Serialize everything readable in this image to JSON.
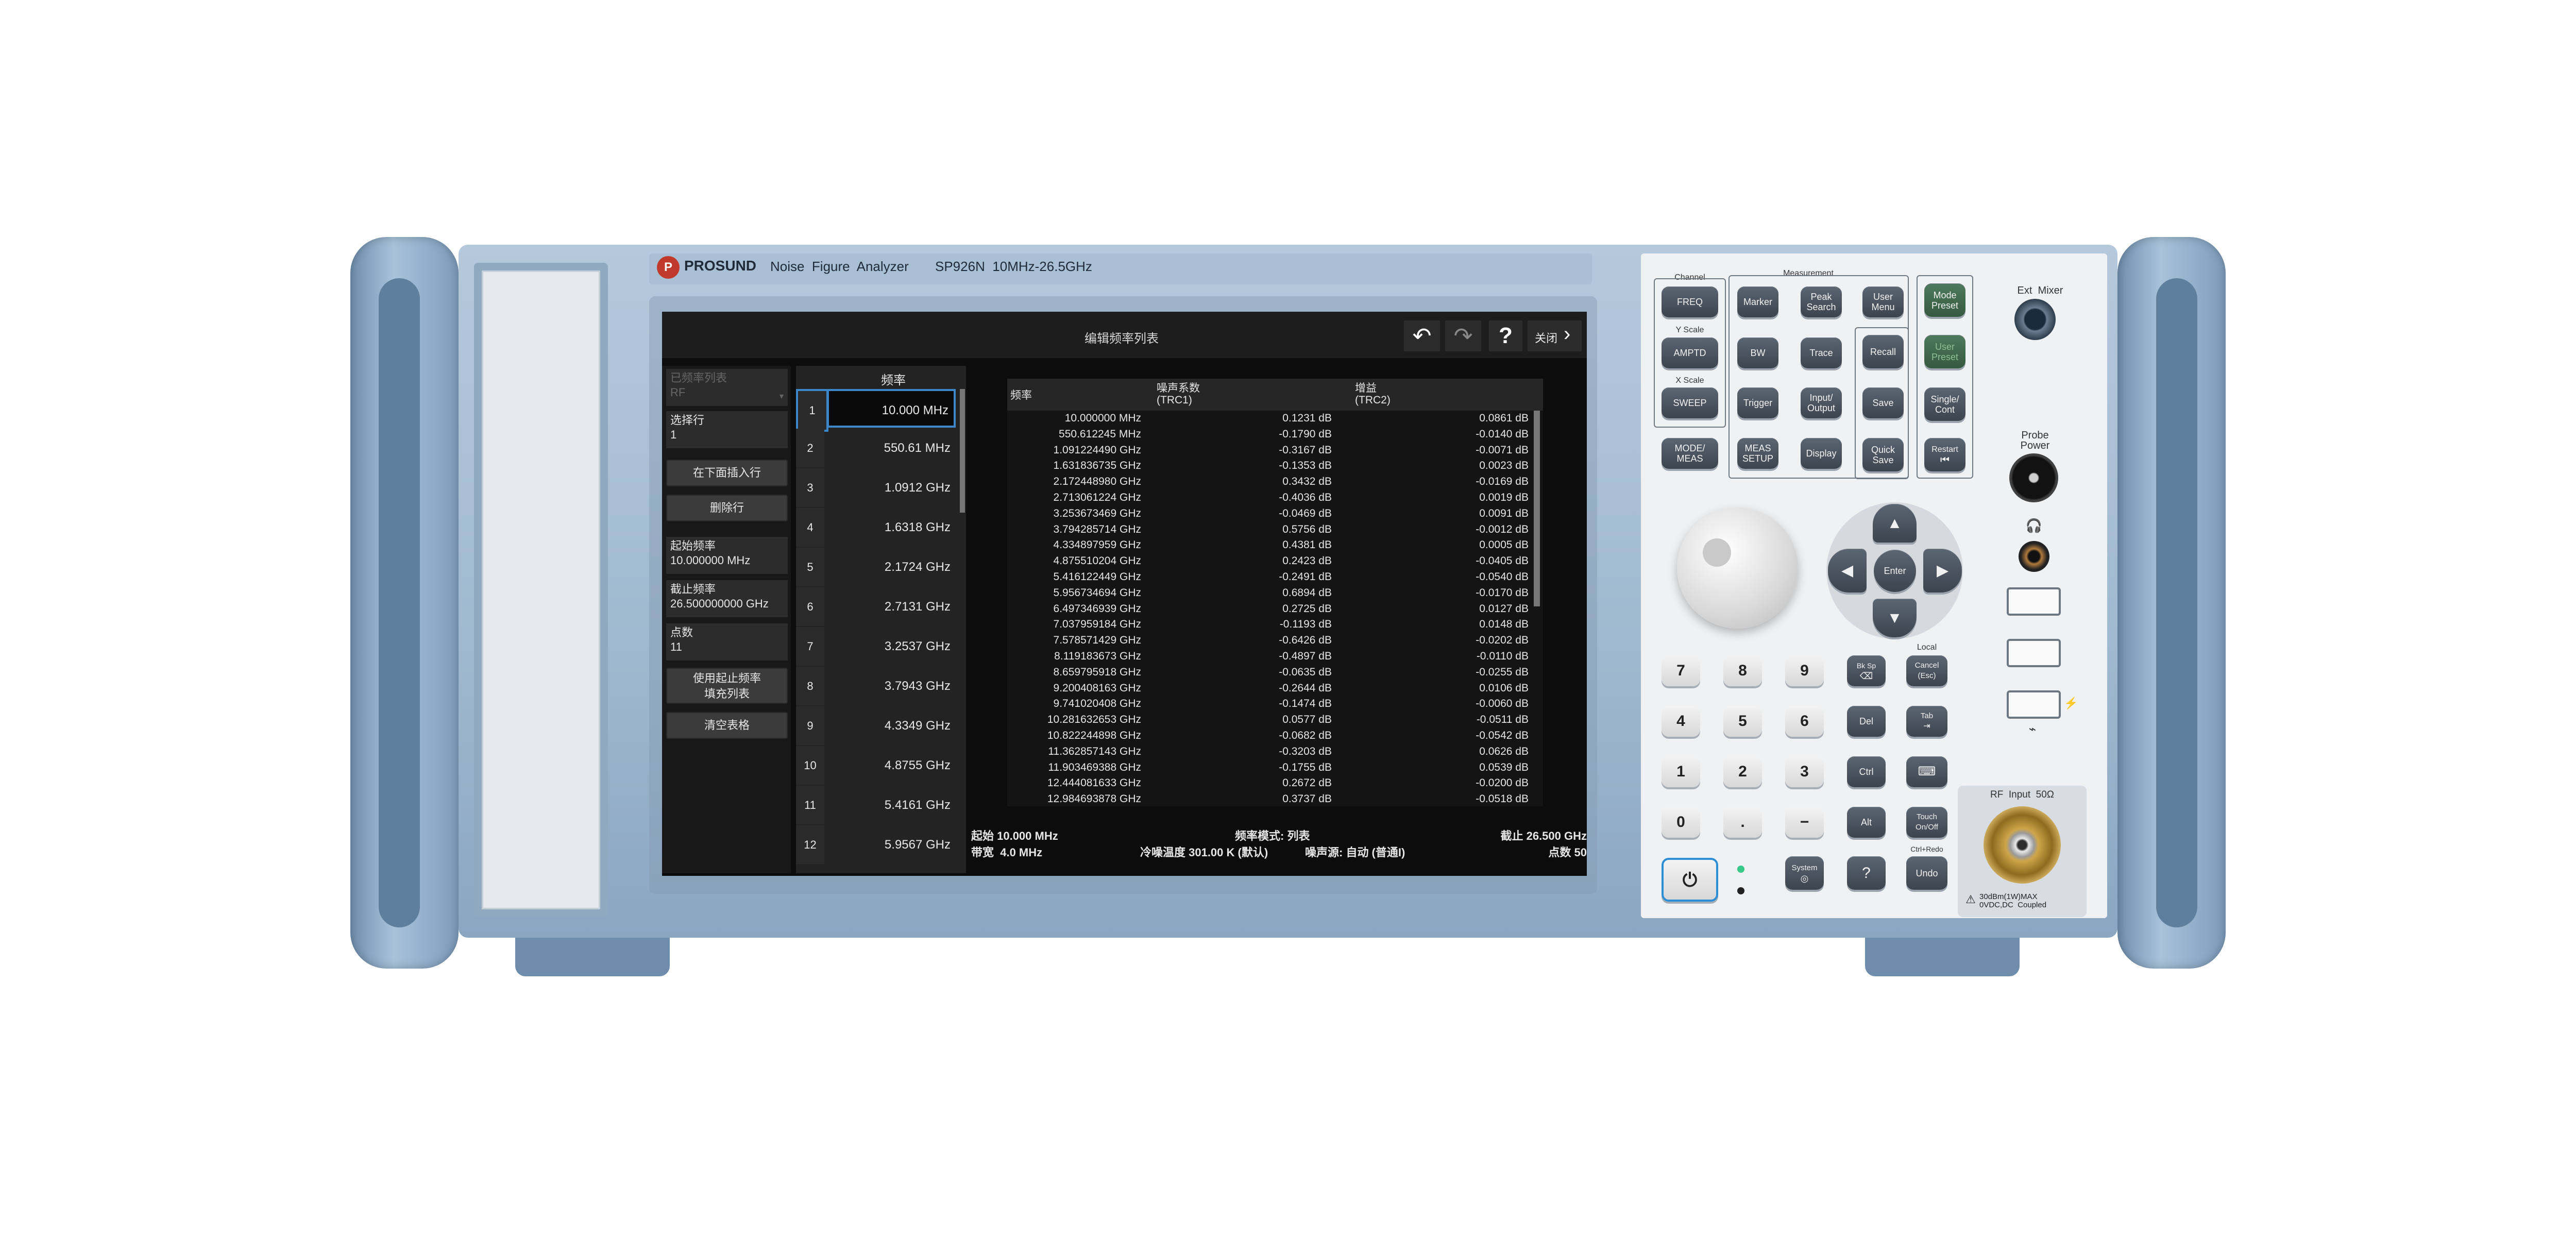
{
  "brand": {
    "logo": "PROSUND",
    "product": "Noise  Figure  Analyzer",
    "model": "SP926N  10MHz-26.5GHz"
  },
  "screen": {
    "dialog_title": "编辑频率列表",
    "close_label": "关闭",
    "left_panel": {
      "list_selector_label": "已频率列表",
      "list_selector_value": "RF",
      "select_row_label": "选择行",
      "select_row_value": "1",
      "insert_below": "在下面插入行",
      "delete_row": "删除行",
      "start_freq_label": "起始频率",
      "start_freq_value": "10.000000 MHz",
      "stop_freq_label": "截止频率",
      "stop_freq_value": "26.500000000 GHz",
      "points_label": "点数",
      "points_value": "11",
      "fill_list": "使用起止频率\n填充列表",
      "clear_table": "清空表格"
    },
    "freq_list": {
      "header": "频率",
      "rows": [
        {
          "n": "1",
          "f": "10.000 MHz"
        },
        {
          "n": "2",
          "f": "550.61 MHz"
        },
        {
          "n": "3",
          "f": "1.0912 GHz"
        },
        {
          "n": "4",
          "f": "1.6318 GHz"
        },
        {
          "n": "5",
          "f": "2.1724 GHz"
        },
        {
          "n": "6",
          "f": "2.7131 GHz"
        },
        {
          "n": "7",
          "f": "3.2537 GHz"
        },
        {
          "n": "8",
          "f": "3.7943 GHz"
        },
        {
          "n": "9",
          "f": "4.3349 GHz"
        },
        {
          "n": "10",
          "f": "4.8755 GHz"
        },
        {
          "n": "11",
          "f": "5.4161 GHz"
        },
        {
          "n": "12",
          "f": "5.9567 GHz"
        }
      ]
    },
    "results_table": {
      "col_freq": "频率",
      "col_nf": "噪声系数",
      "col_nf_sub": "(TRC1)",
      "col_gain": "增益",
      "col_gain_sub": "(TRC2)",
      "rows": [
        [
          "10.000000 MHz",
          "0.1231 dB",
          "0.0861 dB"
        ],
        [
          "550.612245 MHz",
          "-0.1790 dB",
          "-0.0140 dB"
        ],
        [
          "1.091224490 GHz",
          "-0.3167 dB",
          "-0.0071 dB"
        ],
        [
          "1.631836735 GHz",
          "-0.1353 dB",
          "0.0023 dB"
        ],
        [
          "2.172448980 GHz",
          "0.3432 dB",
          "-0.0169 dB"
        ],
        [
          "2.713061224 GHz",
          "-0.4036 dB",
          "0.0019 dB"
        ],
        [
          "3.253673469 GHz",
          "-0.0469 dB",
          "0.0091 dB"
        ],
        [
          "3.794285714 GHz",
          "0.5756 dB",
          "-0.0012 dB"
        ],
        [
          "4.334897959 GHz",
          "0.4381 dB",
          "0.0005 dB"
        ],
        [
          "4.875510204 GHz",
          "0.2423 dB",
          "-0.0405 dB"
        ],
        [
          "5.416122449 GHz",
          "-0.2491 dB",
          "-0.0540 dB"
        ],
        [
          "5.956734694 GHz",
          "0.6894 dB",
          "-0.0170 dB"
        ],
        [
          "6.497346939 GHz",
          "0.2725 dB",
          "0.0127 dB"
        ],
        [
          "7.037959184 GHz",
          "-0.1193 dB",
          "0.0148 dB"
        ],
        [
          "7.578571429 GHz",
          "-0.6426 dB",
          "-0.0202 dB"
        ],
        [
          "8.119183673 GHz",
          "-0.4897 dB",
          "-0.0110 dB"
        ],
        [
          "8.659795918 GHz",
          "-0.0635 dB",
          "-0.0255 dB"
        ],
        [
          "9.200408163 GHz",
          "-0.2644 dB",
          "0.0106 dB"
        ],
        [
          "9.741020408 GHz",
          "-0.1474 dB",
          "-0.0060 dB"
        ],
        [
          "10.281632653 GHz",
          "0.0577 dB",
          "-0.0511 dB"
        ],
        [
          "10.822244898 GHz",
          "-0.0682 dB",
          "-0.0542 dB"
        ],
        [
          "11.362857143 GHz",
          "-0.3203 dB",
          "0.0626 dB"
        ],
        [
          "11.903469388 GHz",
          "-0.1755 dB",
          "0.0539 dB"
        ],
        [
          "12.444081633 GHz",
          "0.2672 dB",
          "-0.0200 dB"
        ],
        [
          "12.984693878 GHz",
          "0.3737 dB",
          "-0.0518 dB"
        ]
      ]
    },
    "status": {
      "start": "起始 10.000 MHz",
      "bandwidth": "带宽  4.0 MHz",
      "freq_mode": "频率模式: 列表",
      "cold_temp": "冷噪温度 301.00 K (默认)",
      "noise_source": "噪声源: 自动 (普通I)",
      "stop": "截止 26.500 GHz",
      "points": "点数 50"
    }
  },
  "keys": {
    "channel_label": "Channel",
    "measurement_label": "Measurement",
    "y_scale_label": "Y Scale",
    "x_scale_label": "X Scale",
    "local_label": "Local",
    "ctrl_redo_label": "Ctrl+Redo",
    "freq": "FREQ",
    "marker": "Marker",
    "peak_search": "Peak\nSearch",
    "user_menu": "User\nMenu",
    "mode_preset": "Mode\nPreset",
    "amptd": "AMPTD",
    "bw": "BW",
    "trace": "Trace",
    "recall": "Recall",
    "user_preset": "User\nPreset",
    "sweep": "SWEEP",
    "trigger": "Trigger",
    "input_output": "Input/\nOutput",
    "save": "Save",
    "single_cont": "Single/\nCont",
    "mode_meas": "MODE/\nMEAS",
    "meas_setup": "MEAS\nSETUP",
    "display": "Display",
    "quick_save": "Quick\nSave",
    "restart": "Restart",
    "enter": "Enter",
    "n7": "7",
    "n8": "8",
    "n9": "9",
    "n4": "4",
    "n5": "5",
    "n6": "6",
    "n1": "1",
    "n2": "2",
    "n3": "3",
    "n0": "0",
    "dot": ".",
    "minus": "−",
    "bksp": "Bk Sp",
    "cancel": "Cancel\n(Esc)",
    "del": "Del",
    "tab": "Tab",
    "ctrl": "Ctrl",
    "alt": "Alt",
    "touch": "Touch\nOn/Off",
    "system": "System",
    "help": "?",
    "undo": "Undo"
  },
  "ports": {
    "ext_mixer": "Ext  Mixer",
    "probe_power": "Probe\nPower",
    "rf_input": "RF  Input  50Ω",
    "rf_warning": "30dBm(1W)MAX\n0VDC,DC  Coupled"
  },
  "colors": {
    "body": "#9fb8cf",
    "screen_bg": "#0c0c0c",
    "selection": "#3b87c9"
  }
}
